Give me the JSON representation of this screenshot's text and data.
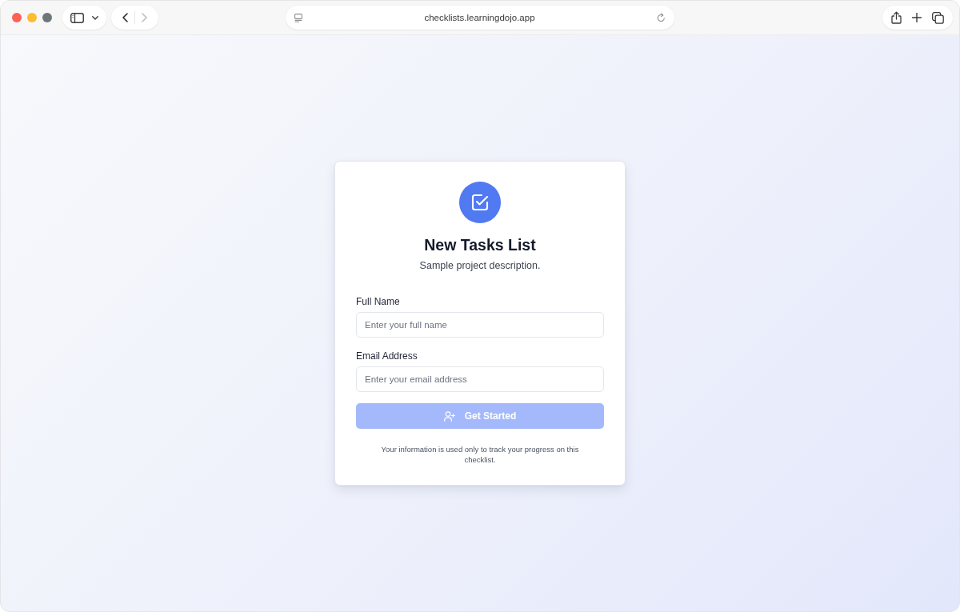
{
  "browser": {
    "traffic_lights": [
      {
        "color": "#ff5f57"
      },
      {
        "color": "#febc2e"
      },
      {
        "color": "#6e7679"
      }
    ],
    "back_button": {
      "disabled": false
    },
    "forward_button": {
      "disabled": true
    },
    "address": "checklists.learningdojo.app"
  },
  "card": {
    "title": "New Tasks List",
    "description": "Sample project description.",
    "fields": [
      {
        "label": "Full Name",
        "placeholder": "Enter your full name"
      },
      {
        "label": "Email Address",
        "placeholder": "Enter your email address"
      }
    ],
    "submit": {
      "label": "Get Started",
      "disabled": true
    },
    "note": "Your information is used only to track your progress on this checklist."
  }
}
